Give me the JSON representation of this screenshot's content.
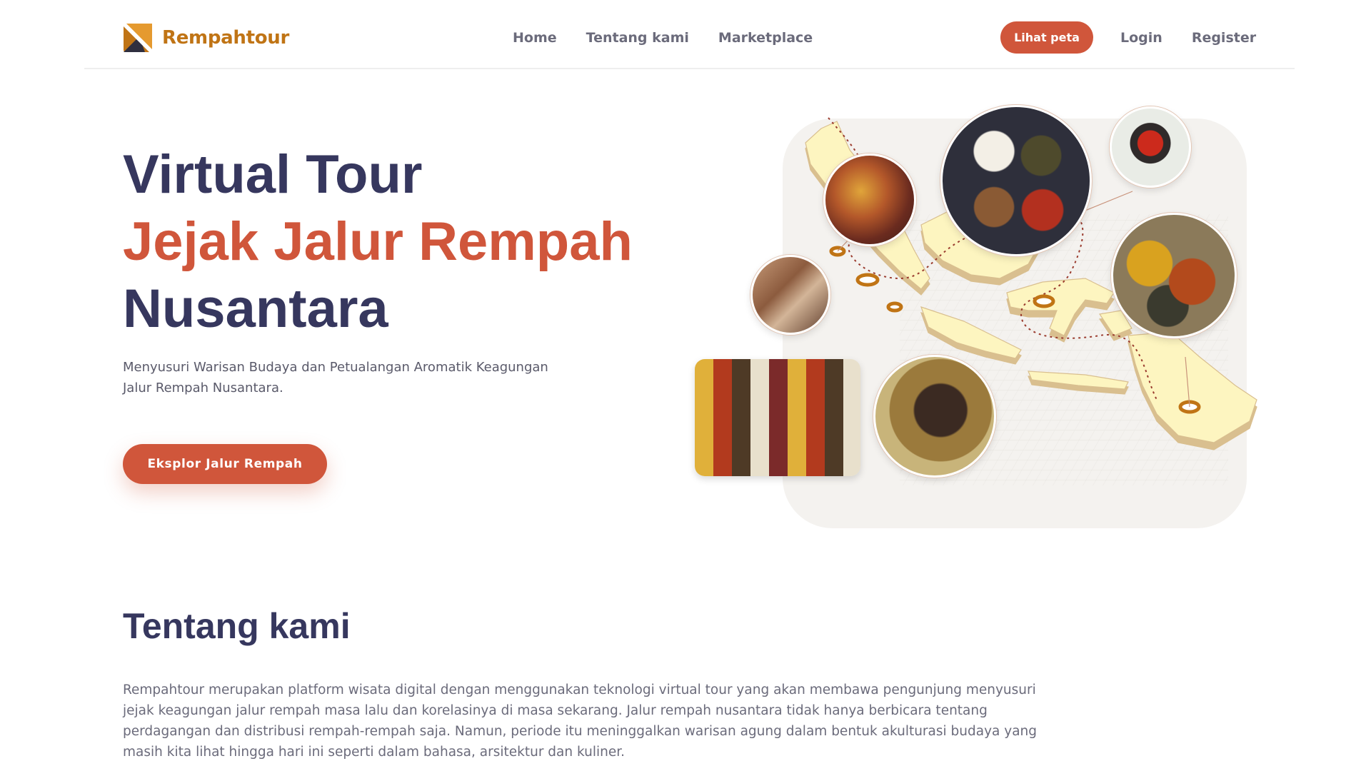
{
  "brand": {
    "name": "Rempahtour",
    "color": "#c07415"
  },
  "nav": {
    "links": [
      "Home",
      "Tentang kami",
      "Marketplace"
    ],
    "map_button": "Lihat peta",
    "login": "Login",
    "register": "Register"
  },
  "hero": {
    "title_line1": "Virtual Tour",
    "title_line2": "Jejak Jalur Rempah",
    "title_line3": "Nusantara",
    "subtitle": "Menyusuri Warisan Budaya dan Petualangan Aromatik Keagungan Jalur Rempah Nusantara.",
    "cta": "Eksplor Jalur Rempah"
  },
  "about": {
    "title": "Tentang kami",
    "text": "Rempahtour merupakan platform wisata digital dengan menggunakan teknologi virtual tour yang akan membawa pengunjung menyusuri jejak keagungan jalur rempah masa lalu dan korelasinya di masa sekarang. Jalur rempah nusantara tidak hanya berbicara tentang perdagangan dan distribusi rempah-rempah saja. Namun, periode itu meninggalkan warisan agung dalam bentuk akulturasi budaya yang masih kita lihat hingga hari ini seperti dalam bahasa, arsitektur dan kuliner."
  },
  "colors": {
    "accent": "#d0563b",
    "navy": "#36375e",
    "map_land": "#fdf5c0",
    "map_edge": "#d9bf8f",
    "pin": "#c07415"
  },
  "icons": {
    "logo": "rempahtour-logo-icon",
    "map": "indonesia-isometric-map-illustration"
  }
}
